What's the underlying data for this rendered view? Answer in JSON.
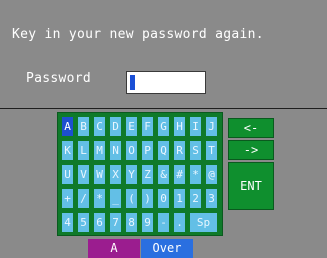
{
  "prompt": "Key in your new password again.",
  "password": {
    "label": "Password",
    "value": ""
  },
  "keyboard": {
    "rows": [
      [
        "A",
        "B",
        "C",
        "D",
        "E",
        "F",
        "G",
        "H",
        "I",
        "J"
      ],
      [
        "K",
        "L",
        "M",
        "N",
        "O",
        "P",
        "Q",
        "R",
        "S",
        "T"
      ],
      [
        "U",
        "V",
        "W",
        "X",
        "Y",
        "Z",
        "&",
        "#",
        "*",
        "@"
      ],
      [
        "+",
        "/",
        "*",
        "_",
        "(",
        ")",
        "0",
        "1",
        "2",
        "3"
      ],
      [
        "4",
        "5",
        "6",
        "7",
        "8",
        "9",
        "-",
        ".",
        "Sp"
      ]
    ],
    "selected": "A"
  },
  "controls": {
    "back": "<-",
    "forward": "->",
    "enter": "ENT"
  },
  "footer": {
    "mode": "A",
    "status": "Over"
  },
  "colors": {
    "key": "#63bfe6",
    "key_selected": "#1d4fd0",
    "keypad_bg": "#0f7a2a",
    "mode_bg": "#9b1d8f",
    "status_bg": "#2a6fe0"
  }
}
